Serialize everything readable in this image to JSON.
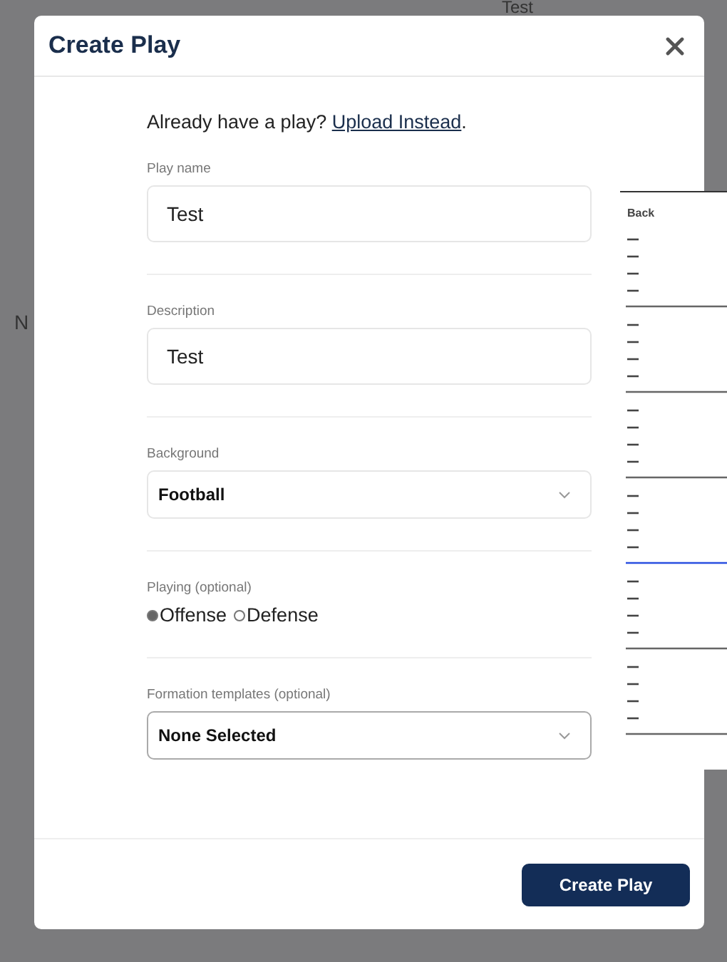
{
  "backdrop": {
    "top_text": "Test",
    "side_text": "N",
    "preview": {
      "label": "Back"
    }
  },
  "dialog": {
    "title": "Create Play",
    "upload_prompt": {
      "text": "Already have a play?",
      "link": "Upload Instead",
      "end": "."
    },
    "fields": [
      {
        "kind": "text",
        "label": "Play name",
        "value": "Test"
      },
      {
        "kind": "text",
        "label": "Description",
        "value": "Test"
      },
      {
        "kind": "select",
        "label": "Background",
        "value": "Football",
        "emphasis": false
      },
      {
        "kind": "radio",
        "label": "Playing (optional)",
        "options": [
          {
            "label": "Offense",
            "selected": true
          },
          {
            "label": "Defense",
            "selected": false
          }
        ]
      },
      {
        "kind": "select",
        "label": "Formation templates (optional)",
        "value": "None Selected",
        "emphasis": true
      }
    ],
    "submit": "Create Play"
  }
}
